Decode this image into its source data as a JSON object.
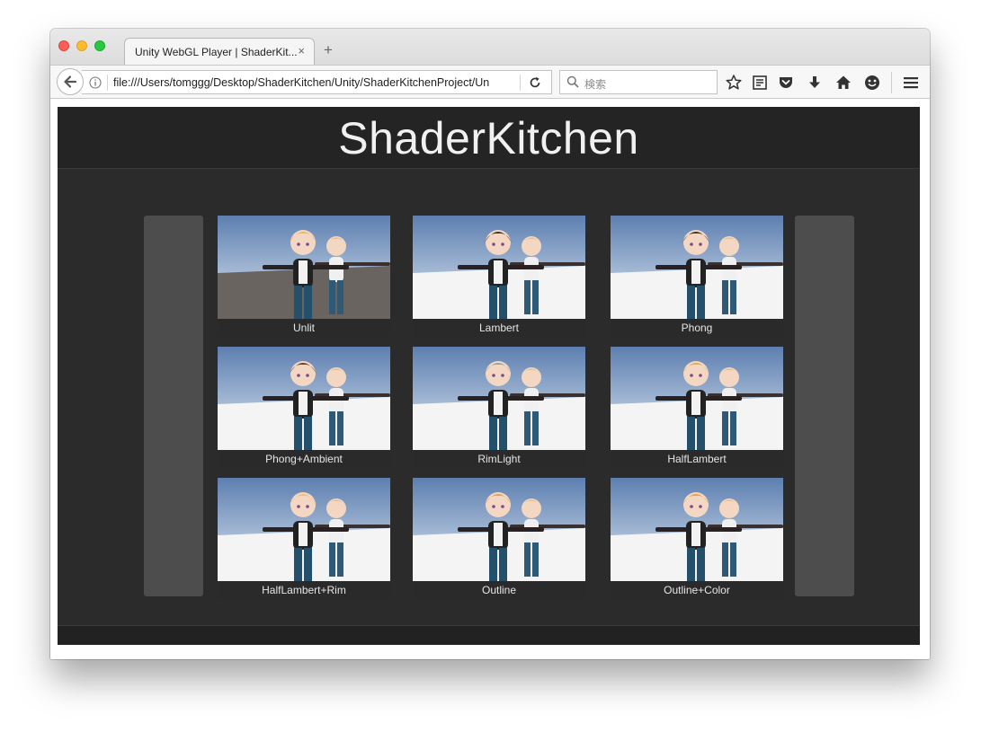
{
  "browser": {
    "tab_title": "Unity WebGL Player | ShaderKit...",
    "tab_close": "×",
    "new_tab": "+",
    "url": "file:///Users/tomggg/Desktop/ShaderKitchen/Unity/ShaderKitchenProject/Un",
    "search_placeholder": "検索",
    "icons": [
      "back-arrow-icon",
      "info-icon",
      "reload-icon",
      "search-icon",
      "bookmark-star-icon",
      "reader-view-icon",
      "pocket-icon",
      "download-icon",
      "home-icon",
      "emoji-icon",
      "hamburger-menu-icon"
    ]
  },
  "app": {
    "title": "ShaderKitchen",
    "tiles": [
      {
        "label": "Unlit",
        "style": "unlit"
      },
      {
        "label": "Lambert",
        "style": "lambert"
      },
      {
        "label": "Phong",
        "style": "phong"
      },
      {
        "label": "Phong+Ambient",
        "style": "phong-ambient"
      },
      {
        "label": "RimLight",
        "style": "rimlight"
      },
      {
        "label": "HalfLambert",
        "style": "halflambert"
      },
      {
        "label": "HalfLambert+Rim",
        "style": "halflambert-rim"
      },
      {
        "label": "Outline",
        "style": "outline"
      },
      {
        "label": "Outline+Color",
        "style": "outline-color"
      }
    ]
  },
  "colors": {
    "canvas_bg": "#2b2b2b",
    "header_bg": "#242424",
    "side_panel": "#4d4d4d",
    "sky_top": "#5d7fb0",
    "sky_bottom": "#dfe9f2",
    "floor": "#f4f4f4"
  }
}
